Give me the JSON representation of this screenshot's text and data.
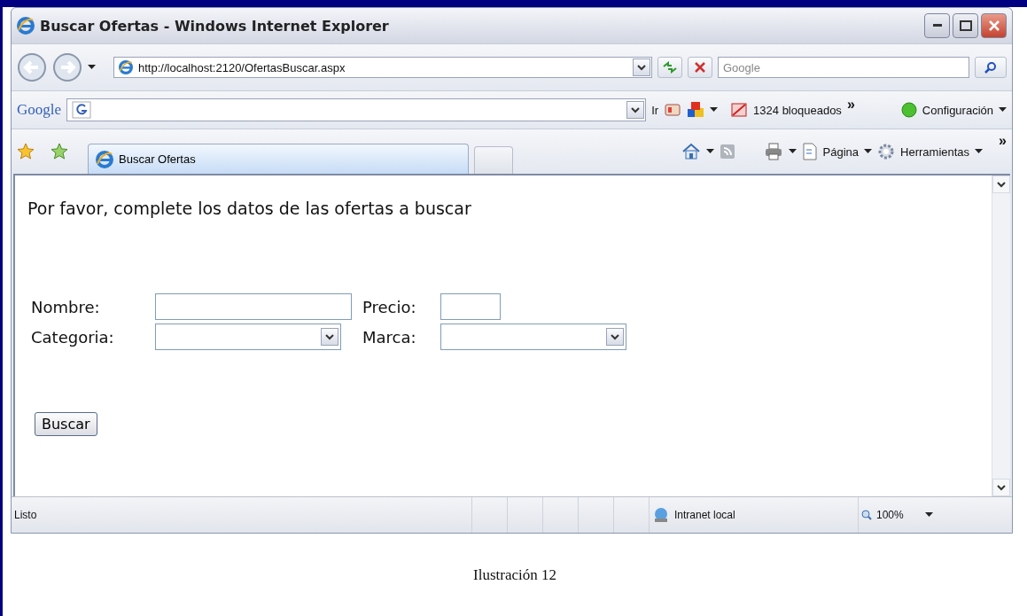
{
  "window": {
    "title": "Buscar Ofertas - Windows Internet Explorer"
  },
  "address_bar": {
    "url": "http://localhost:2120/OfertasBuscar.aspx",
    "search_placeholder": "Google"
  },
  "google_toolbar": {
    "logo": "Google",
    "go": "Ir",
    "blocked": "1324 bloqueados",
    "more": "»",
    "settings": "Configuración"
  },
  "tabs": [
    {
      "label": "Buscar Ofertas",
      "selected": true
    }
  ],
  "command_bar": {
    "page": "Página",
    "tools": "Herramientas",
    "more": "»"
  },
  "page": {
    "heading": "Por favor, complete los datos de las ofertas a buscar",
    "fields": [
      {
        "label": "Nombre:",
        "kind": "text"
      },
      {
        "label": "Precio:",
        "kind": "short"
      },
      {
        "label": "Categoria:",
        "kind": "select"
      },
      {
        "label": "Marca:",
        "kind": "select"
      }
    ],
    "button": "Buscar"
  },
  "status_bar": {
    "status": "Listo",
    "zone": "Intranet local",
    "zoom": "100%"
  },
  "caption": "Ilustración 12"
}
